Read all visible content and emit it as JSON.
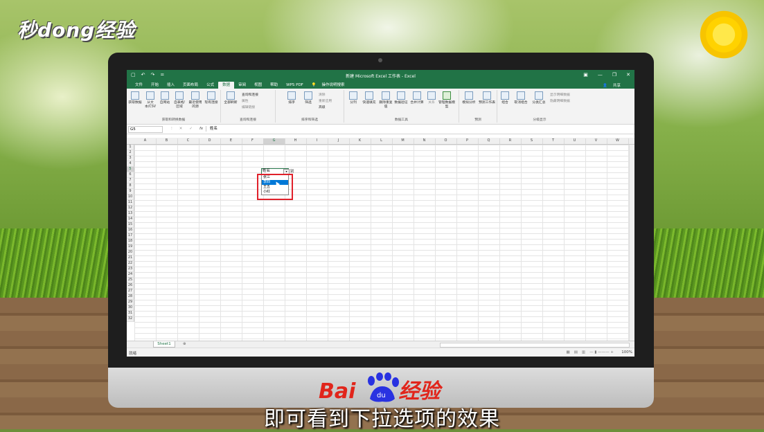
{
  "watermark": {
    "top_left": "秒dong经验",
    "bottom_baidu": "Bai",
    "bottom_jingyan": "经验",
    "paw_text": "du"
  },
  "subtitle": "即可看到下拉选项的效果",
  "excel": {
    "window_title": "新建 Microsoft Excel 工作表 - Excel",
    "quick_access": [
      "▢",
      "↶",
      "↷",
      "="
    ],
    "window_controls": [
      "▣",
      "—",
      "❐",
      "✕"
    ],
    "menu": [
      "文件",
      "开始",
      "插入",
      "页面布局",
      "公式",
      "数据",
      "审阅",
      "视图",
      "帮助",
      "WPS PDF",
      "操作说明搜索"
    ],
    "active_menu": "数据",
    "share": "共享",
    "ribbon": {
      "get_data": [
        "获取数据",
        "从文本/CSV",
        "自网站",
        "自表格/区域",
        "最近使用的源",
        "现有连接"
      ],
      "group_get": "获取和转换数据",
      "refresh": "全部刷新",
      "query_small": [
        "查询和连接",
        "属性",
        "编辑链接"
      ],
      "group_query": "查询和连接",
      "sort": [
        "排序",
        "筛选"
      ],
      "sort_small": [
        "清除",
        "重新应用",
        "高级"
      ],
      "group_sort": "排序和筛选",
      "tools": [
        "分列",
        "快速填充",
        "删除重复值",
        "数据验证",
        "合并计算",
        "关系",
        "管理数据模型"
      ],
      "group_tools": "数据工具",
      "forecast": [
        "模拟分析",
        "预测工作表"
      ],
      "group_forecast": "预测",
      "outline": [
        "组合",
        "取消组合",
        "分类汇总"
      ],
      "outline_small": [
        "显示明细数据",
        "隐藏明细数据"
      ],
      "group_outline": "分级显示"
    },
    "name_box": "G5",
    "formula_icons": [
      "⁝",
      "✕",
      "✓",
      "fx"
    ],
    "formula_content": "姓名",
    "columns": [
      "A",
      "B",
      "C",
      "D",
      "E",
      "F",
      "G",
      "H",
      "I",
      "J",
      "K",
      "L",
      "M",
      "N",
      "O",
      "P",
      "Q",
      "R",
      "S",
      "T",
      "U",
      "V",
      "W"
    ],
    "rows": [
      "1",
      "2",
      "3",
      "4",
      "5",
      "6",
      "7",
      "8",
      "9",
      "10",
      "11",
      "12",
      "13",
      "14",
      "15",
      "16",
      "17",
      "18",
      "19",
      "20",
      "21",
      "22",
      "23",
      "24",
      "25",
      "26",
      "27",
      "28",
      "29",
      "30",
      "31",
      "32"
    ],
    "cell_g5": "姓名",
    "cell_h5_partial": "别",
    "dropdown_arrow": "▾",
    "dropdown_options": [
      "张三",
      "李四",
      "王五",
      "小红"
    ],
    "dropdown_selected_index": 1,
    "sheet_tab": "Sheet1",
    "add_sheet": "⊕",
    "status": "就绪",
    "zoom": "100%"
  },
  "colors": {
    "excel_green": "#217346",
    "selection_blue": "#0078d7",
    "highlight_red": "#e0202a"
  }
}
